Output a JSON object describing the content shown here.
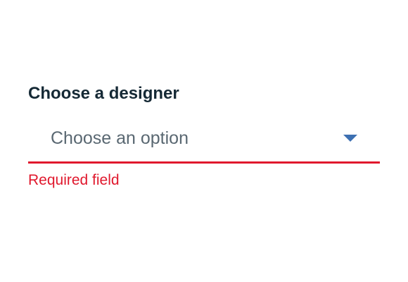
{
  "field": {
    "label": "Choose a designer",
    "selected_text": "Choose an option",
    "error_message": "Required field",
    "icon": "chevron-down-icon"
  },
  "colors": {
    "label": "#152935",
    "placeholder": "#5a6872",
    "accent": "#3d70b2",
    "error": "#e0182d",
    "background": "#ffffff"
  }
}
